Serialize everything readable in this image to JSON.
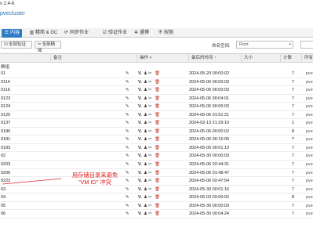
{
  "window": {
    "title": "v 2.4-6"
  },
  "breadcrumb": {
    "cluster": "pvecluster"
  },
  "tabs": [
    {
      "label": "内容",
      "icon": "list-icon",
      "active": true
    },
    {
      "label": "精简 & GC",
      "icon": "trim-icon",
      "active": false
    },
    {
      "label": "同步作业",
      "icon": "sync-icon",
      "active": false
    },
    {
      "label": "验证作业",
      "icon": "check-icon",
      "active": false
    },
    {
      "label": "通博",
      "icon": "gear-icon",
      "active": false
    },
    {
      "label": "权限",
      "icon": "shield-icon",
      "active": false
    }
  ],
  "toolbar": {
    "verify_all": "全部验证",
    "prune_all": "全部精简",
    "namespace_label": "命名空间:",
    "namespace_value": "Root"
  },
  "columns": {
    "note": "备注",
    "actions": "操作",
    "last_backup": "最后的时间",
    "size": "大小",
    "count": "计数",
    "owner": "所有"
  },
  "group_label": "群组",
  "rows": [
    {
      "id": "01",
      "time": "2024-05-29 00:00:02",
      "count": "7",
      "owner": "pvec"
    },
    {
      "id": "0114",
      "time": "2024-05-06 00:00:03",
      "count": "7",
      "owner": "pvec"
    },
    {
      "id": "0116",
      "time": "2024-05-06 00:00:03",
      "count": "7",
      "owner": "pvec"
    },
    {
      "id": "0123",
      "time": "2024-05-06 00:04:01",
      "count": "7",
      "owner": "pvec"
    },
    {
      "id": "0124",
      "time": "2024-05-06 00:00:03",
      "count": "7",
      "owner": "pvec"
    },
    {
      "id": "0125",
      "time": "2024-05-06 01:51:21",
      "count": "7",
      "owner": "pvec"
    },
    {
      "id": "0137",
      "time": "2024-02-13 21:29:10",
      "count": "1",
      "owner": "pvec"
    },
    {
      "id": "0180",
      "time": "2024-05-06 00:00:02",
      "count": "8",
      "owner": "pvec"
    },
    {
      "id": "0181",
      "time": "2024-05-06 00:15:05",
      "count": "7",
      "owner": "pvec"
    },
    {
      "id": "0183",
      "time": "2024-05-06 00:01:13",
      "count": "7",
      "owner": "pvec"
    },
    {
      "id": "02",
      "time": "2024-05-30 00:00:03",
      "count": "7",
      "owner": "pvec"
    },
    {
      "id": "0203",
      "time": "2024-05-06 02:44:31",
      "count": "7",
      "owner": "pvec"
    },
    {
      "id": "0206",
      "time": "2024-05-06 01:48:47",
      "count": "7",
      "owner": "pvec"
    },
    {
      "id": "0222",
      "time": "2024-05-06 02:47:54",
      "count": "7",
      "owner": "pvec"
    },
    {
      "id": "03",
      "time": "2024-05-30 00:01:16",
      "count": "7",
      "owner": "pvec"
    },
    {
      "id": "04",
      "time": "2024-06-03 00:00:02",
      "count": "8",
      "owner": "pvec"
    },
    {
      "id": "05",
      "time": "2024-05-30 00:00:03",
      "count": "7",
      "owner": "pvec"
    },
    {
      "id": "06",
      "time": "2024-05-30 00:04:24",
      "count": "7",
      "owner": "pvec"
    }
  ],
  "annotation": {
    "line1": "用存储目录来避免",
    "line2": "\"VM ID\" 冲突",
    "color": "#e02020"
  },
  "colors": {
    "accent": "#2e7bc6",
    "delete": "#c0392b"
  }
}
